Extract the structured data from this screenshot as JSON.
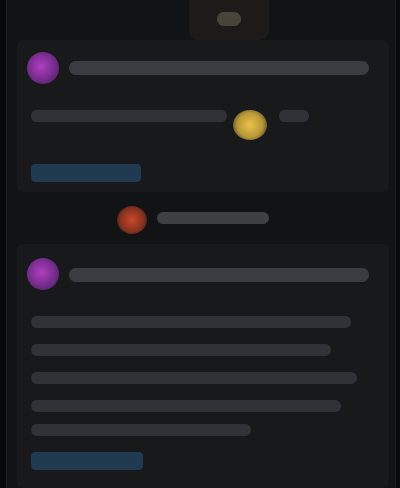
{
  "colors": {
    "background": "#08090a",
    "card": "#17191b",
    "avatar_accent": "#b03fc0",
    "link_accent": "#23425f",
    "emoji_yellow": "#e7c24a",
    "emoji_red": "#c64a2a"
  },
  "top_tab": {
    "icon": "app-icon"
  },
  "posts": [
    {
      "avatar_icon": "user-avatar",
      "emoji_icon": "emoji-yellow-icon"
    },
    {
      "avatar_icon": "user-avatar"
    }
  ],
  "divider": {
    "emoji_icon": "emoji-red-icon"
  }
}
